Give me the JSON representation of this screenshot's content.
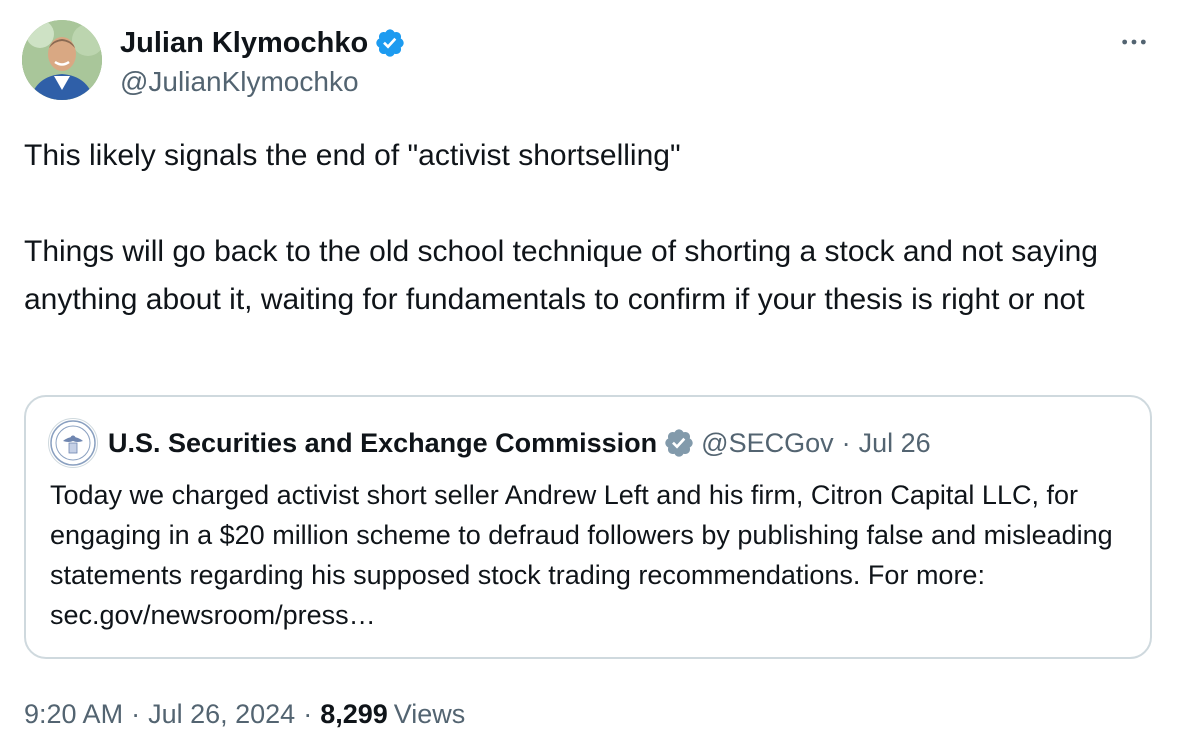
{
  "author": {
    "display_name": "Julian Klymochko",
    "handle": "@JulianKlymochko",
    "verified": true,
    "verified_color": "#1d9bf0"
  },
  "tweet": {
    "paragraphs": [
      "This likely signals the end of \"activist shortselling\"",
      "Things will go back to the old school technique of shorting a stock and not saying anything about it, waiting for fundamentals to confirm if your thesis is right or not"
    ]
  },
  "quote": {
    "display_name": "U.S. Securities and Exchange Commission",
    "handle": "@SECGov",
    "separator": "·",
    "date": "Jul 26",
    "verified_color": "#829aab",
    "text": "Today we charged activist short seller Andrew Left and his firm, Citron Capital LLC, for engaging in a $20 million scheme to defraud followers by publishing false and misleading statements regarding his supposed stock trading recommendations. For more: ",
    "link_text": "sec.gov/newsroom/press…"
  },
  "meta": {
    "time": "9:20 AM",
    "separator": "·",
    "date": "Jul 26, 2024",
    "views_count": "8,299",
    "views_label": "Views"
  },
  "icons": {
    "more": "more-horizontal-icon",
    "verified": "verified-badge-icon"
  },
  "colors": {
    "text_primary": "#0f1419",
    "text_secondary": "#536471",
    "border": "#cfd9de"
  }
}
